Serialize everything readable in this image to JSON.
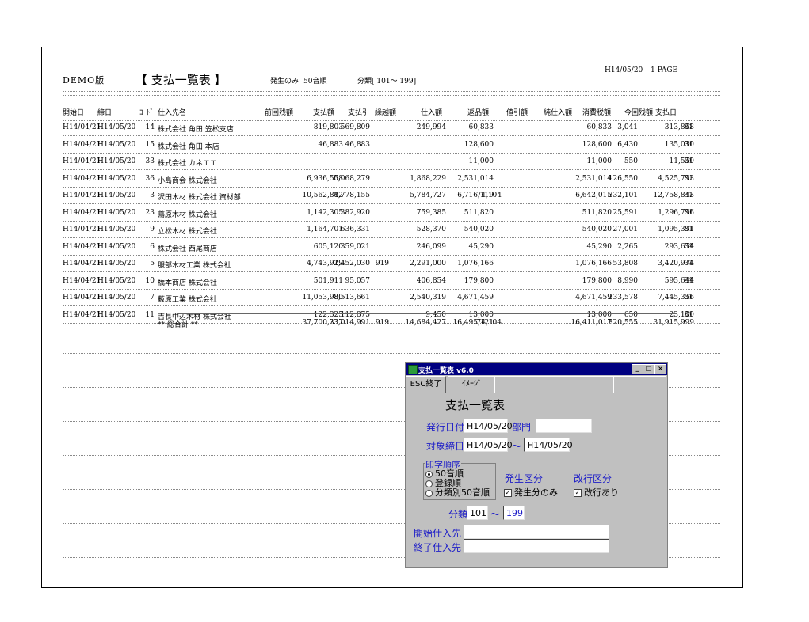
{
  "report": {
    "demo_label": "DEMO版",
    "title": "【 支払一覧表 】",
    "option1": "発生のみ",
    "option2": "50音順",
    "classification": "分類[ 101～ 199]",
    "date": "H14/05/20",
    "page": "1 PAGE"
  },
  "columns": [
    "開始日",
    "締日",
    "ｺｰﾄﾞ",
    "仕入先名",
    "前回残額",
    "支払額",
    "支払引",
    "繰越額",
    "仕入額",
    "返品額",
    "値引額",
    "純仕入額",
    "消費税額",
    "今回残額",
    "支払日"
  ],
  "rows": [
    [
      "H14/04/21",
      "H14/05/20",
      "14",
      "株式会社 角田 笠松支店",
      "819,803",
      "569,809",
      "",
      "249,994",
      "60,833",
      "",
      "",
      "60,833",
      "3,041",
      "313,868",
      "31"
    ],
    [
      "H14/04/21",
      "H14/05/20",
      "15",
      "株式会社 角田 本店",
      "46,883",
      "46,883",
      "",
      "",
      "128,600",
      "",
      "",
      "128,600",
      "6,430",
      "135,030",
      "31"
    ],
    [
      "H14/04/21",
      "H14/05/20",
      "33",
      "株式会社 カネエエ",
      "",
      "",
      "",
      "",
      "11,000",
      "",
      "",
      "11,000",
      "550",
      "11,550",
      "31"
    ],
    [
      "H14/04/21",
      "H14/05/20",
      "36",
      "小島商会 株式会社",
      "6,936,508",
      "5,068,279",
      "",
      "1,868,229",
      "2,531,014",
      "",
      "",
      "2,531,014",
      "126,550",
      "4,525,793",
      "31"
    ],
    [
      "H14/04/21",
      "H14/05/20",
      "3",
      "沢田木材 株式会社  資材部",
      "10,562,882",
      "4,778,155",
      "",
      "5,784,727",
      "6,716,119",
      "74,104",
      "",
      "6,642,015",
      "332,101",
      "12,758,843",
      "31"
    ],
    [
      "H14/04/21",
      "H14/05/20",
      "23",
      "蔦原木材 株式会社",
      "1,142,305",
      "382,920",
      "",
      "759,385",
      "511,820",
      "",
      "",
      "511,820",
      "25,591",
      "1,296,796",
      "31"
    ],
    [
      "H14/04/21",
      "H14/05/20",
      "9",
      "立松木材 株式会社",
      "1,164,701",
      "636,331",
      "",
      "528,370",
      "540,020",
      "",
      "",
      "540,020",
      "27,001",
      "1,095,391",
      "31"
    ],
    [
      "H14/04/21",
      "H14/05/20",
      "6",
      "株式会社 西尾商店",
      "605,120",
      "359,021",
      "",
      "246,099",
      "45,290",
      "",
      "",
      "45,290",
      "2,265",
      "293,654",
      "31"
    ],
    [
      "H14/04/21",
      "H14/05/20",
      "5",
      "服部木材工業 株式会社",
      "4,743,919",
      "2,452,030",
      "919",
      "2,291,000",
      "1,076,166",
      "",
      "",
      "1,076,166",
      "53,808",
      "3,420,974",
      "31"
    ],
    [
      "H14/04/21",
      "H14/05/20",
      "10",
      "橋本商店 株式会社",
      "501,911",
      "95,057",
      "",
      "406,854",
      "179,800",
      "",
      "",
      "179,800",
      "8,990",
      "595,644",
      "31"
    ],
    [
      "H14/04/21",
      "H14/05/20",
      "7",
      "藪原工業 株式会社",
      "11,053,980",
      "8,513,661",
      "",
      "2,540,319",
      "4,671,459",
      "",
      "",
      "4,671,459",
      "233,578",
      "7,445,356",
      "31"
    ],
    [
      "H14/04/21",
      "H14/05/20",
      "11",
      "吉長中辺木材 株式会社",
      "122,325",
      "112,875",
      "",
      "9,450",
      "13,000",
      "",
      "",
      "13,000",
      "650",
      "23,100",
      "31"
    ]
  ],
  "total": {
    "label": "** 総合計 **",
    "values": [
      "37,700,337",
      "23,014,991",
      "919",
      "14,684,427",
      "16,495,121",
      "74,104",
      "",
      "16,411,017",
      "820,555",
      "31,915,999"
    ]
  },
  "dialog": {
    "title": "支払一覧表 v6.0",
    "esc_button": "ESC終了",
    "image_button": "ｲﾒｰｼﾞ",
    "heading": "支払一覧表",
    "issue_date_label": "発行日付",
    "issue_date": "H14/05/20",
    "dept_label": "部門",
    "dept_value": "",
    "closing_label": "対象締日",
    "closing_from": "H14/05/20",
    "tilde": "～",
    "closing_to": "H14/05/20",
    "print_order_label": "印字順序",
    "order_options": [
      "50音順",
      "登録順",
      "分類別50音順"
    ],
    "selected_order": 0,
    "occurrence_label": "発生区分",
    "occurrence_check": "発生分のみ",
    "pagebreak_label": "改行区分",
    "pagebreak_check": "改行あり",
    "class_label": "分類",
    "class_from": "101",
    "class_to": "199",
    "start_supplier_label": "開始仕入先",
    "end_supplier_label": "終了仕入先",
    "start_supplier": "",
    "end_supplier": "",
    "minimize": "_",
    "maximize": "□",
    "close": "×"
  }
}
